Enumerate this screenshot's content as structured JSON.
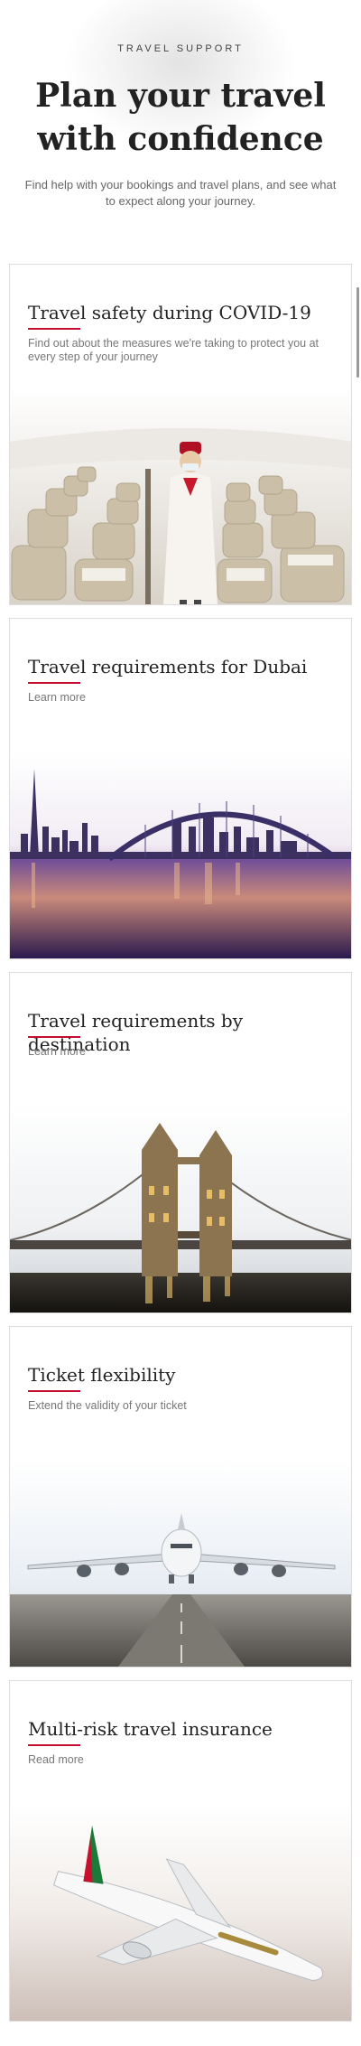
{
  "header": {
    "eyebrow": "TRAVEL SUPPORT",
    "title": "Plan your travel with confidence",
    "lead": "Find help with your bookings and travel plans, and see what to expect along your journey."
  },
  "cards": [
    {
      "title": "Travel safety during COVID-19",
      "text": "Find out about the measures we're taking to protect you at every step of your journey"
    },
    {
      "title": "Travel requirements for Dubai",
      "text": "Learn more"
    },
    {
      "title": "Travel requirements by destination",
      "text": "Learn more"
    },
    {
      "title": "Ticket flexibility",
      "text": "Extend the validity of your ticket"
    },
    {
      "title": "Multi-risk travel insurance",
      "text": "Read more"
    }
  ],
  "colors": {
    "accent": "#c60c30",
    "text": "#222222",
    "muted": "#777777"
  },
  "images": [
    "cabin-crew-image",
    "dubai-skyline-image",
    "tower-bridge-image",
    "a380-runway-image",
    "emirates-aircraft-image"
  ]
}
